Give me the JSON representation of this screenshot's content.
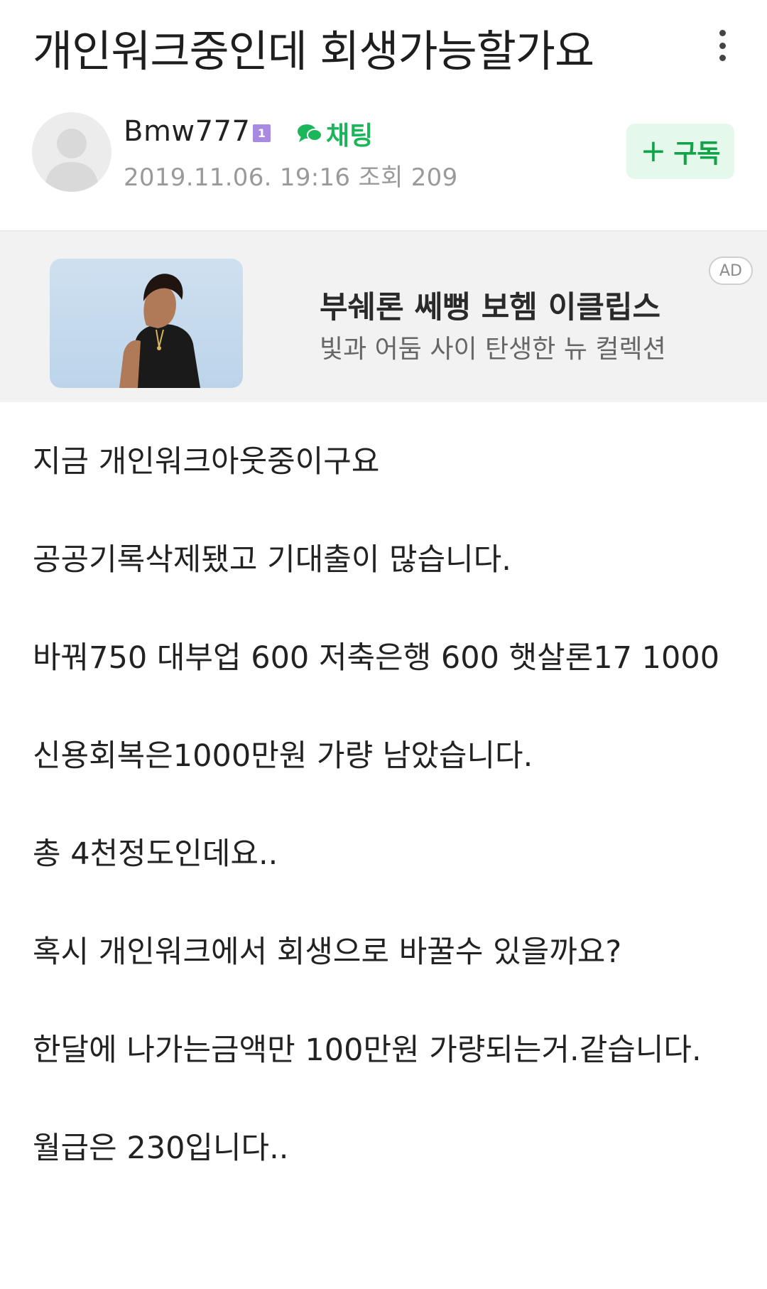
{
  "post": {
    "title": "개인워크중인데 회생가능할가요",
    "more_icon": "more-vertical-icon"
  },
  "author": {
    "name": "Bmw777",
    "grade": "1",
    "chat_label": "채팅",
    "date": "2019.11.06. 19:16",
    "views": "조회 209",
    "subscribe_label": "구독"
  },
  "ad": {
    "title": "부쉐론 쎄뻥 보헴 이클립스",
    "description": "빛과 어둠 사이 탄생한 뉴 컬렉션",
    "badge": "AD"
  },
  "body": {
    "paragraphs": [
      "지금 개인워크아웃중이구요",
      "공공기록삭제됐고 기대출이 많습니다.",
      "바꿔750 대부업 600 저축은행 600 햇살론17 1000",
      "신용회복은1000만원 가량 남았습니다.",
      "총 4천정도인데요..",
      "혹시 개인워크에서 회생으로 바꿀수 있을까요?",
      "한달에 나가는금액만 100만원 가량되는거.같습니다.",
      "월급은 230입니다.."
    ]
  },
  "colors": {
    "accent_green": "#1bb65a",
    "subscribe_bg": "#e5f8ec",
    "grade_badge": "#a88be0"
  }
}
